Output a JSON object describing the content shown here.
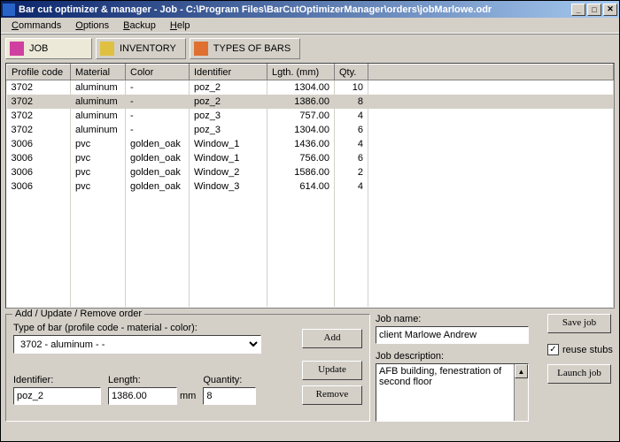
{
  "title": "Bar cut optimizer & manager - Job - C:\\Program Files\\BarCutOptimizerManager\\orders\\jobMarlowe.odr",
  "menu": [
    "Commands",
    "Options",
    "Backup",
    "Help"
  ],
  "tabs": [
    {
      "label": "JOB",
      "icon": "pink"
    },
    {
      "label": "INVENTORY",
      "icon": "yellow"
    },
    {
      "label": "TYPES OF BARS",
      "icon": "orange"
    }
  ],
  "columns": [
    "Profile code",
    "Material",
    "Color",
    "Identifier",
    "Lgth. (mm)",
    "Qty."
  ],
  "rows": [
    {
      "pc": "3702",
      "mat": "aluminum",
      "col": "-",
      "id": "poz_2",
      "lg": "1304.00",
      "qty": "10",
      "sel": false
    },
    {
      "pc": "3702",
      "mat": "aluminum",
      "col": "-",
      "id": "poz_2",
      "lg": "1386.00",
      "qty": "8",
      "sel": true
    },
    {
      "pc": "3702",
      "mat": "aluminum",
      "col": "-",
      "id": "poz_3",
      "lg": "757.00",
      "qty": "4",
      "sel": false
    },
    {
      "pc": "3702",
      "mat": "aluminum",
      "col": "-",
      "id": "poz_3",
      "lg": "1304.00",
      "qty": "6",
      "sel": false
    },
    {
      "pc": "3006",
      "mat": "pvc",
      "col": "golden_oak",
      "id": "Window_1",
      "lg": "1436.00",
      "qty": "4",
      "sel": false
    },
    {
      "pc": "3006",
      "mat": "pvc",
      "col": "golden_oak",
      "id": "Window_1",
      "lg": "756.00",
      "qty": "6",
      "sel": false
    },
    {
      "pc": "3006",
      "mat": "pvc",
      "col": "golden_oak",
      "id": "Window_2",
      "lg": "1586.00",
      "qty": "2",
      "sel": false
    },
    {
      "pc": "3006",
      "mat": "pvc",
      "col": "golden_oak",
      "id": "Window_3",
      "lg": "614.00",
      "qty": "4",
      "sel": false
    }
  ],
  "group": {
    "title": "Add / Update / Remove order",
    "typeLabel": "Type of bar (profile code - material - color):",
    "typeValue": "3702 - aluminum - -",
    "identLabel": "Identifier:",
    "identValue": "poz_2",
    "lenLabel": "Length:",
    "lenValue": "1386.00",
    "lenUnit": "mm",
    "qtyLabel": "Quantity:",
    "qtyValue": "8",
    "btnAdd": "Add",
    "btnUpdate": "Update",
    "btnRemove": "Remove"
  },
  "right": {
    "jobNameLabel": "Job name:",
    "jobName": "client Marlowe Andrew",
    "jobDescLabel": "Job description:",
    "jobDesc": "AFB building, fenestration of second floor",
    "saveBtn": "Save job",
    "reuse": "reuse stubs",
    "reuseChecked": true,
    "launchBtn": "Launch job"
  }
}
